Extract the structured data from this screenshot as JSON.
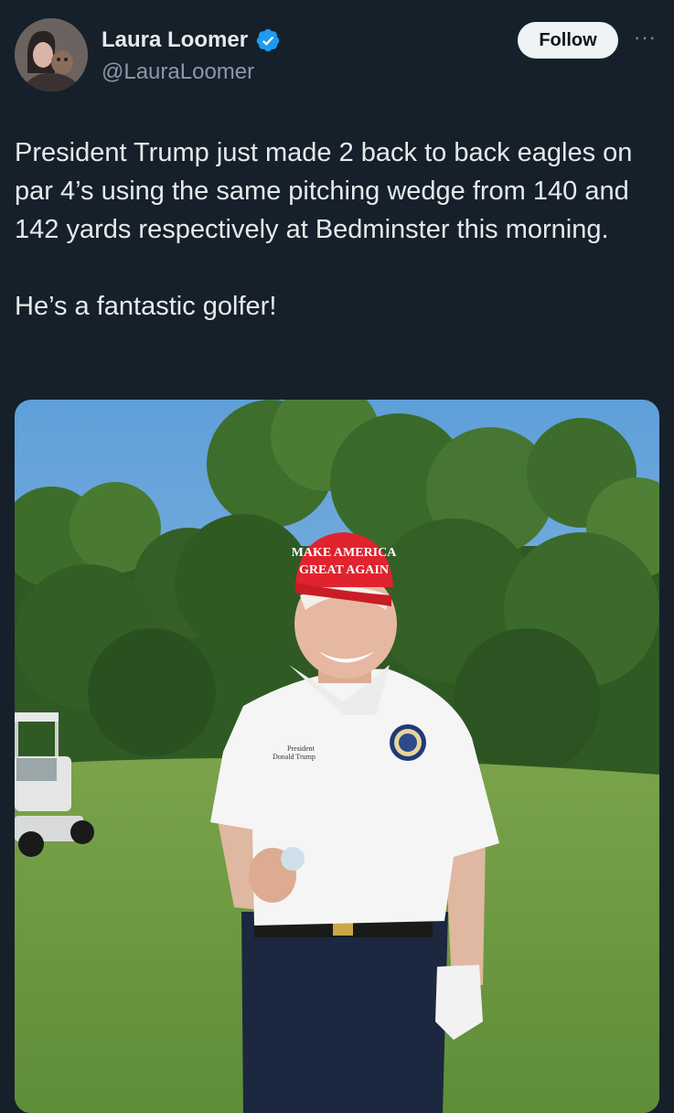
{
  "author": {
    "display_name": "Laura Loomer",
    "handle": "@LauraLoomer",
    "verified": true,
    "avatar_icon": "profile-avatar"
  },
  "actions": {
    "follow_label": "Follow",
    "more_label": "···"
  },
  "tweet": {
    "text": "President Trump just made 2 back to back eagles on par 4’s using the same pitching wedge from 140 and 142 yards respectively at Bedminster this morning.\n\nHe’s a fantastic golfer!"
  },
  "media": {
    "description_icon": "golf-course-photo",
    "hat_text_line1": "MAKE AMERICA",
    "hat_text_line2": "GREAT AGAIN",
    "shirt_text_line1": "President",
    "shirt_text_line2": "Donald Trump"
  },
  "colors": {
    "background": "#15202b",
    "text": "#e7e9ea",
    "secondary": "#8b98a5",
    "verified": "#1d9bf0"
  }
}
